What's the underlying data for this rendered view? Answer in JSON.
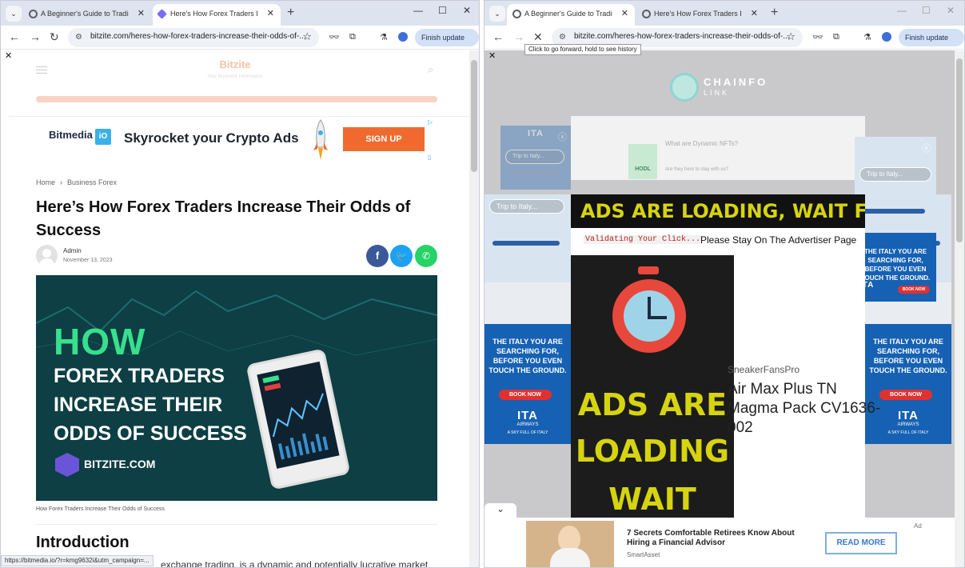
{
  "left": {
    "tabs": [
      {
        "title": "A Beginner's Guide to Trading: |"
      },
      {
        "title": "Here's How Forex Traders Increa"
      }
    ],
    "url": "bitzite.com/heres-how-forex-traders-increase-their-odds-of-...",
    "finish_update": "Finish update",
    "site": {
      "brand": "Bitzite",
      "tagline": "Your Business Information"
    },
    "ad": {
      "logo": "Bitmedia",
      "logo_io": "iO",
      "text": "Skyrocket your Crypto Ads",
      "cta": "SIGN UP"
    },
    "breadcrumb": {
      "home": "Home",
      "sep": "›",
      "category": "Business Forex"
    },
    "article": {
      "title": "Here’s How Forex Traders Increase Their Odds of Success",
      "author": "Admin",
      "date": "November 13, 2023",
      "hero": {
        "line1": "HOW",
        "line2": "FOREX TRADERS",
        "line3": "INCREASE THEIR",
        "line4": "ODDS OF SUCCESS",
        "brand": "BITZITE.COM"
      },
      "caption": "How Forex Traders Increase Their Odds of Success",
      "intro_heading": "Introduction",
      "intro_text": "exchange trading, is a dynamic and potentially lucrative market"
    },
    "status_url": "https://bitmedia.io/?r=kmg9632i&utm_campaign=..."
  },
  "right": {
    "tabs": [
      {
        "title": "A Beginner's Guide to Trading: |"
      },
      {
        "title": "Here's How Forex Traders Increa"
      }
    ],
    "url": "bitzite.com/heres-how-forex-traders-increase-their-odds-of-...",
    "finish_update": "Finish update",
    "tooltip": "Click to go forward, hold to see history",
    "site": {
      "brand_line1": "CHAINFO",
      "brand_line2": "LINK"
    },
    "faded_ad": {
      "title": "What are Dynamic NFTs?",
      "sub": "Are they here to stay with us?",
      "hodl": "HODL"
    },
    "side_ad": {
      "search": "Trip to Italy...",
      "headline1": "THE ITALY YOU ARE",
      "headline2": "SEARCHING FOR,",
      "headline3": "BEFORE YOU EVEN",
      "headline4": "TOUCH THE GROUND.",
      "book": "BOOK NOW",
      "logo": "ITA",
      "airways": "AIRWAYS",
      "sky": "A SKY FULL OF ITALY"
    },
    "loading_banner": "ADS ARE LOADING, WAIT FEW MOMI",
    "validating": "Validating Your Click...",
    "stay": "Please Stay On The Advertiser Page",
    "big_loading": [
      "ADS ARE",
      "LOADING",
      "WAIT FEW"
    ],
    "sneaker": {
      "brand": "SneakerFansPro",
      "title": "Air Max Plus TN Magma Pack CV1636-002"
    },
    "bottom_ad": {
      "title": "7 Secrets Comfortable Retirees Know About Hiring a Financial Advisor",
      "source": "SmartAsset",
      "cta": "READ MORE",
      "label": "Ad"
    }
  },
  "colors": {
    "accent": "#f06a30",
    "green": "#37e08c",
    "loading_yellow": "#d6d40e",
    "ita_blue": "#1661b3"
  }
}
